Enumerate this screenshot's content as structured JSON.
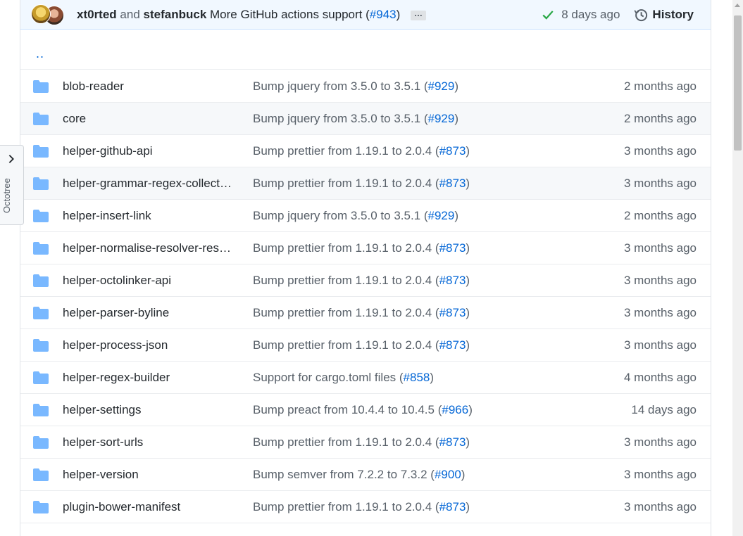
{
  "commit": {
    "author1": "xt0rted",
    "connector": "and",
    "author2": "stefanbuck",
    "message_prefix": "More GitHub actions support (",
    "pr": "#943",
    "message_suffix": ")",
    "ellipsis": "…",
    "age": "8 days ago",
    "history_label": "History"
  },
  "parent_link": "..",
  "octotree": {
    "label": "Octotree"
  },
  "colors": {
    "link": "#0366d6",
    "folder": "#79b8ff",
    "check": "#28a745"
  },
  "rows": [
    {
      "name": "blob-reader",
      "msg": "Bump jquery from 3.5.0 to 3.5.1 (",
      "pr": "#929",
      "close": ")",
      "age": "2 months ago"
    },
    {
      "name": "core",
      "msg": "Bump jquery from 3.5.0 to 3.5.1 (",
      "pr": "#929",
      "close": ")",
      "age": "2 months ago"
    },
    {
      "name": "helper-github-api",
      "msg": "Bump prettier from 1.19.1 to 2.0.4 (",
      "pr": "#873",
      "close": ")",
      "age": "3 months ago"
    },
    {
      "name": "helper-grammar-regex-collect…",
      "msg": "Bump prettier from 1.19.1 to 2.0.4 (",
      "pr": "#873",
      "close": ")",
      "age": "3 months ago"
    },
    {
      "name": "helper-insert-link",
      "msg": "Bump jquery from 3.5.0 to 3.5.1 (",
      "pr": "#929",
      "close": ")",
      "age": "2 months ago"
    },
    {
      "name": "helper-normalise-resolver-res…",
      "msg": "Bump prettier from 1.19.1 to 2.0.4 (",
      "pr": "#873",
      "close": ")",
      "age": "3 months ago"
    },
    {
      "name": "helper-octolinker-api",
      "msg": "Bump prettier from 1.19.1 to 2.0.4 (",
      "pr": "#873",
      "close": ")",
      "age": "3 months ago"
    },
    {
      "name": "helper-parser-byline",
      "msg": "Bump prettier from 1.19.1 to 2.0.4 (",
      "pr": "#873",
      "close": ")",
      "age": "3 months ago"
    },
    {
      "name": "helper-process-json",
      "msg": "Bump prettier from 1.19.1 to 2.0.4 (",
      "pr": "#873",
      "close": ")",
      "age": "3 months ago"
    },
    {
      "name": "helper-regex-builder",
      "msg": "Support for cargo.toml files (",
      "pr": "#858",
      "close": ")",
      "age": "4 months ago"
    },
    {
      "name": "helper-settings",
      "msg": "Bump preact from 10.4.4 to 10.4.5 (",
      "pr": "#966",
      "close": ")",
      "age": "14 days ago"
    },
    {
      "name": "helper-sort-urls",
      "msg": "Bump prettier from 1.19.1 to 2.0.4 (",
      "pr": "#873",
      "close": ")",
      "age": "3 months ago"
    },
    {
      "name": "helper-version",
      "msg": "Bump semver from 7.2.2 to 7.3.2 (",
      "pr": "#900",
      "close": ")",
      "age": "3 months ago"
    },
    {
      "name": "plugin-bower-manifest",
      "msg": "Bump prettier from 1.19.1 to 2.0.4 (",
      "pr": "#873",
      "close": ")",
      "age": "3 months ago"
    }
  ]
}
